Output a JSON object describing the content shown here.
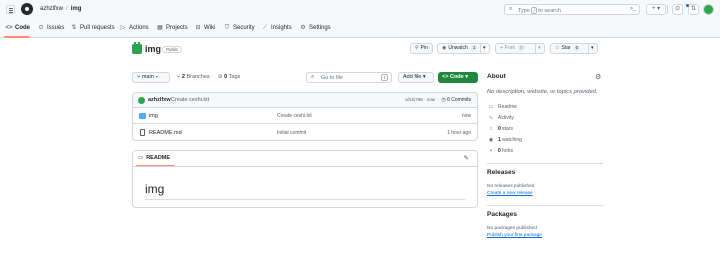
{
  "header": {
    "owner": "azhzlfxw",
    "separator": "/",
    "repo": "img",
    "search": {
      "prefix": "Type",
      "key": "/",
      "suffix": "to search"
    },
    "command_palette": ">_",
    "create_button": "+ ▾",
    "issues_icon": "issue-icon",
    "pulls_icon": "pull-request-icon",
    "inbox_icon": "inbox-icon"
  },
  "nav": {
    "tabs": [
      {
        "label": "Code",
        "icon": "<>"
      },
      {
        "label": "Issues",
        "icon": "⊙"
      },
      {
        "label": "Pull requests",
        "icon": "⇅"
      },
      {
        "label": "Actions",
        "icon": "▷"
      },
      {
        "label": "Projects",
        "icon": "▦"
      },
      {
        "label": "Wiki",
        "icon": "⊟"
      },
      {
        "label": "Security",
        "icon": "⛉"
      },
      {
        "label": "Insights",
        "icon": "⟋"
      },
      {
        "label": "Settings",
        "icon": "⚙"
      }
    ]
  },
  "repo": {
    "name": "img",
    "visibility": "Public",
    "pin_label": "Pin",
    "unwatch_label": "Unwatch",
    "unwatch_count": "1",
    "fork_label": "Fork",
    "fork_count": "0",
    "star_label": "Star",
    "star_count": "0"
  },
  "toolbar": {
    "branch": "main",
    "branches_count": "2",
    "branches_label": "Branches",
    "tags_count": "0",
    "tags_label": "Tags",
    "goto_placeholder": "Go to file",
    "goto_key": "t",
    "add_file_label": "Add file",
    "code_label": "Code"
  },
  "commit": {
    "user": "azhzlfxw",
    "message": "Create ceshi.txt",
    "info": "a7d1768 · now",
    "count_label": "6 Commits"
  },
  "files": [
    {
      "type": "folder",
      "name": "img",
      "message": "Create ceshi.txt",
      "date": "now"
    },
    {
      "type": "file",
      "name": "README.md",
      "message": "Initial commit",
      "date": "1 hour ago"
    }
  ],
  "readme": {
    "tab": "README",
    "heading": "img"
  },
  "sidebar": {
    "about_heading": "About",
    "description": "No description, website, or topics provided.",
    "items": [
      {
        "icon": "▭",
        "pre": "",
        "bold": "",
        "text": "Readme"
      },
      {
        "icon": "∿",
        "pre": "",
        "bold": "",
        "text": "Activity"
      },
      {
        "icon": "☆",
        "pre": "",
        "bold": "0",
        "text": " stars"
      },
      {
        "icon": "◉",
        "pre": "",
        "bold": "1",
        "text": " watching"
      },
      {
        "icon": "⑂",
        "pre": "",
        "bold": "0",
        "text": " forks"
      }
    ],
    "releases_heading": "Releases",
    "releases_note": "No releases published",
    "releases_link": "Create a new release",
    "packages_heading": "Packages",
    "packages_note": "No packages published",
    "packages_link": "Publish your first package"
  },
  "colors": {
    "accent_green": "#1f883d",
    "link_blue": "#0969da",
    "tab_underline": "#fd8c73"
  }
}
